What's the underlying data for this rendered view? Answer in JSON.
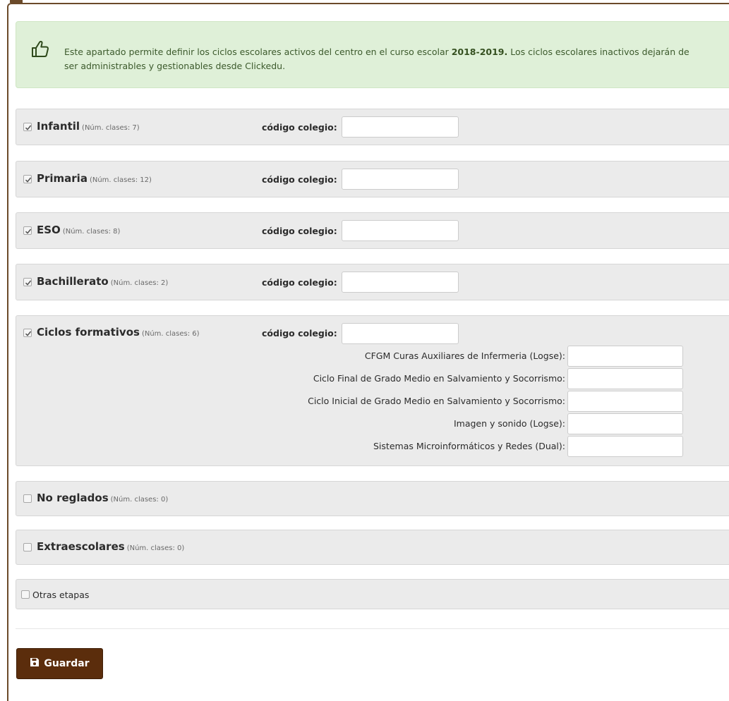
{
  "alert": {
    "icon": "thumbs-up-icon",
    "text_before": "Este apartado permite definir los ciclos escolares activos del centro en el curso escolar ",
    "year": "2018-2019.",
    "text_after": " Los ciclos escolares inactivos dejarán de ser administrables y gestionables desde Clickedu."
  },
  "code_label": "código colegio:",
  "stages": [
    {
      "name": "Infantil",
      "count": "(Núm. clases: 7)",
      "checked": true
    },
    {
      "name": "Primaria",
      "count": "(Núm. clases: 12)",
      "checked": true
    },
    {
      "name": "ESO",
      "count": "(Núm. clases: 8)",
      "checked": true
    },
    {
      "name": "Bachillerato",
      "count": "(Núm. clases: 2)",
      "checked": true
    },
    {
      "name": "Ciclos formativos",
      "count": "(Núm. clases: 6)",
      "checked": true
    },
    {
      "name": "No reglados",
      "count": "(Núm. clases: 0)",
      "checked": false
    },
    {
      "name": "Extraescolares",
      "count": "(Núm. clases: 0)",
      "checked": false
    }
  ],
  "ciclos_sub": [
    "CFGM Curas Auxiliares de Infermeria (Logse):",
    "Ciclo Final de Grado Medio en Salvamiento y Socorrismo:",
    "Ciclo Inicial de Grado Medio en Salvamiento y Socorrismo:",
    "Imagen y sonido (Logse):",
    "Sistemas Microinformáticos y Redes (Dual):"
  ],
  "otras": {
    "label": "Otras etapas",
    "checked": false
  },
  "save_button": {
    "label": "Guardar",
    "icon": "floppy-disk-icon"
  }
}
